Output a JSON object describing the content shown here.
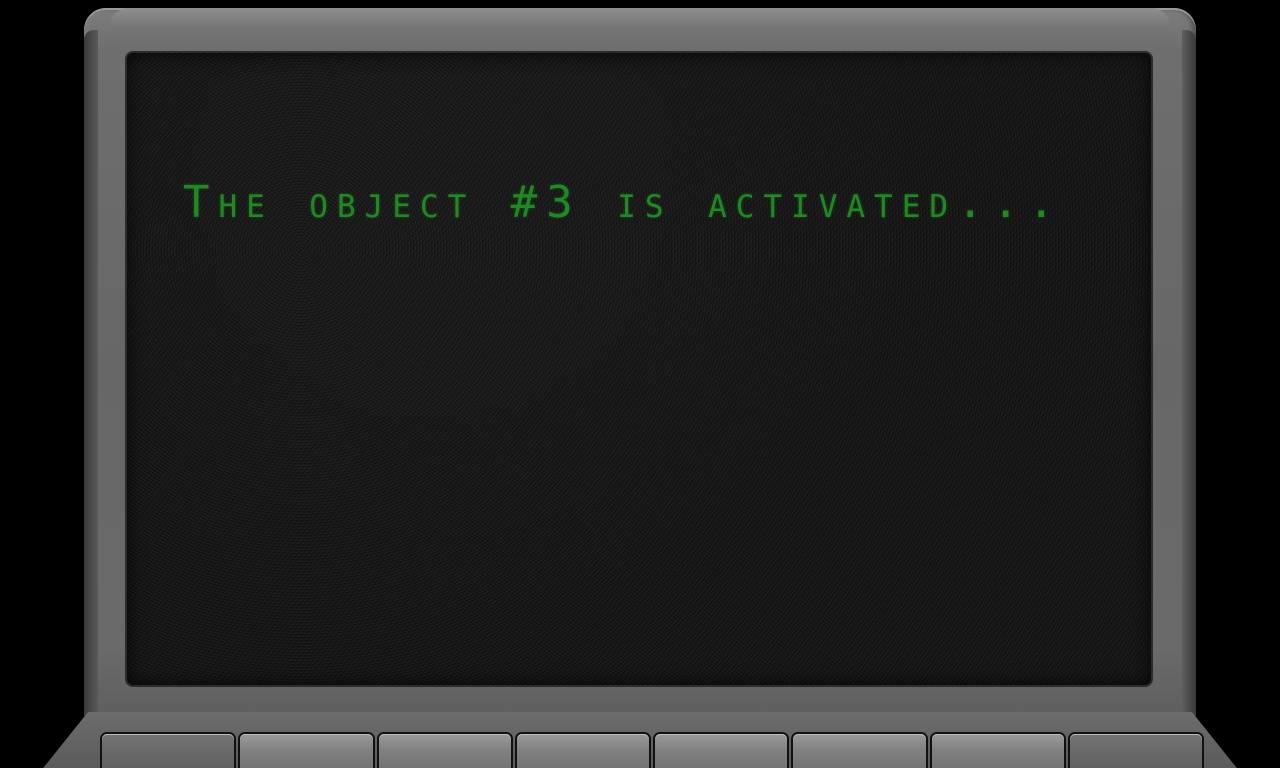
{
  "screen": {
    "message": "The object #3 is activated...",
    "text_color": "#1f8a22",
    "background_color": "#151515"
  },
  "laptop": {
    "bezel_color": "#6a6a6a",
    "key_count": 8
  }
}
